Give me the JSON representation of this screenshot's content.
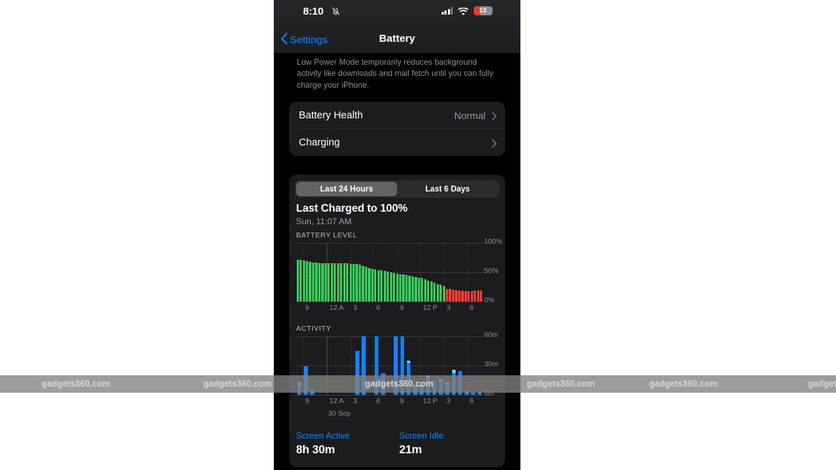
{
  "statusbar": {
    "time": "8:10",
    "bell_icon": "bell-slash-icon",
    "cellular_icon": "cellular-bars-icon",
    "wifi_icon": "wifi-icon",
    "battery_percent": "13"
  },
  "navbar": {
    "back_label": "Settings",
    "back_icon": "chevron-left-icon",
    "title": "Battery"
  },
  "low_power_note": "Low Power Mode temporarily reduces background activity like downloads and mail fetch until you can fully charge your iPhone.",
  "settings_rows": [
    {
      "label": "Battery Health",
      "value": "Normal",
      "chevron": "chevron-right-icon"
    },
    {
      "label": "Charging",
      "value": "",
      "chevron": "chevron-right-icon"
    }
  ],
  "segmented": {
    "options": [
      "Last 24 Hours",
      "Last 6 Days"
    ],
    "selected": "Last 24 Hours"
  },
  "last_charged": {
    "title": "Last Charged to 100%",
    "subtitle": "Sun, 11:07 AM"
  },
  "sections": {
    "battery_level_label": "BATTERY LEVEL",
    "activity_label": "ACTIVITY",
    "date_label": "30 Sep"
  },
  "footer": {
    "screen_active_label": "Screen Active",
    "screen_active_value": "8h 30m",
    "screen_idle_label": "Screen Idle",
    "screen_idle_value": "21m"
  },
  "colors": {
    "accent_blue": "#0a84ff",
    "battery_green": "#30d158",
    "battery_red": "#ff3b30",
    "activity_blue": "#0a84ff",
    "activity_light_blue": "#64d2ff",
    "card_bg": "#1c1c1e",
    "page_bg": "#000000"
  },
  "watermark": {
    "text": "gadgets360.com",
    "positions": [
      60,
      292,
      524,
      756,
      932,
      1160
    ]
  },
  "chart_data": [
    {
      "type": "bar",
      "title": "BATTERY LEVEL",
      "ylabel": "",
      "xlabel": "",
      "ylim": [
        0,
        100
      ],
      "yticks": [
        0,
        50,
        100
      ],
      "ytick_labels": [
        "0%",
        "50%",
        "100%"
      ],
      "xtick_labels": [
        "9",
        "12 A",
        "3",
        "6",
        "9",
        "12 P",
        "3",
        "6"
      ],
      "xtick_positions": [
        0.035,
        0.165,
        0.29,
        0.415,
        0.54,
        0.665,
        0.79,
        0.915
      ],
      "grid": true,
      "series": [
        {
          "name": "Battery level",
          "unit": "%",
          "color_high": "#30d158",
          "color_low": "#ff3b30",
          "low_threshold_index": 48,
          "values": [
            72,
            71,
            70,
            69,
            68,
            67,
            67,
            66,
            66,
            65,
            65,
            65,
            65,
            65,
            65,
            65,
            65,
            64,
            64,
            64,
            63,
            61,
            59,
            57,
            56,
            55,
            54,
            53,
            52,
            51,
            50,
            49,
            48,
            47,
            46,
            45,
            44,
            43,
            42,
            41,
            40,
            38,
            36,
            34,
            32,
            30,
            28,
            26,
            22,
            21,
            20,
            19,
            19,
            18,
            18,
            18,
            18,
            19,
            19,
            19
          ]
        }
      ]
    },
    {
      "type": "bar",
      "title": "ACTIVITY",
      "ylabel": "",
      "xlabel": "",
      "ylim": [
        0,
        60
      ],
      "yticks": [
        0,
        30,
        60
      ],
      "ytick_labels": [
        "0m",
        "30m",
        "60m"
      ],
      "xtick_labels": [
        "9",
        "12 A",
        "3",
        "6",
        "9",
        "12 P",
        "3",
        "6"
      ],
      "xtick_positions": [
        0.035,
        0.165,
        0.29,
        0.415,
        0.54,
        0.665,
        0.79,
        0.915
      ],
      "grid": true,
      "series": [
        {
          "name": "Screen Active",
          "unit": "m",
          "color": "#0a84ff",
          "values": [
            9,
            29,
            6,
            0,
            0,
            0,
            0,
            0,
            0,
            45,
            60,
            0,
            60,
            22,
            0,
            60,
            60,
            33,
            10,
            8,
            17,
            15,
            14,
            11,
            22,
            24,
            4,
            2,
            3
          ]
        },
        {
          "name": "Screen Idle",
          "unit": "m",
          "color": "#64d2ff",
          "values": [
            4,
            0,
            0,
            0,
            0,
            0,
            0,
            0,
            0,
            0,
            0,
            0,
            0,
            0,
            0,
            0,
            0,
            2,
            0,
            2,
            3,
            0,
            2,
            2,
            4,
            0,
            0,
            0,
            0
          ]
        }
      ],
      "bar_slots": 29
    }
  ]
}
